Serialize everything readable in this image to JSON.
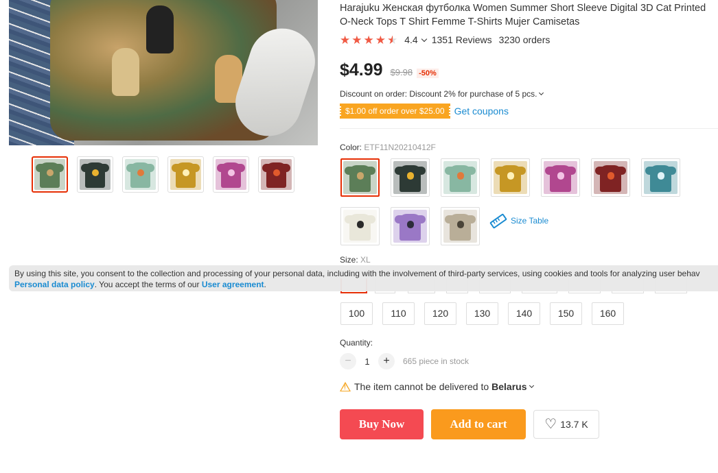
{
  "product": {
    "title": "Harajuku Женская футболка Women Summer Short Sleeve Digital 3D Cat Printed O-Neck Tops T Shirt Femme T-Shirts Mujer Camisetas",
    "rating": 4.4,
    "rating_text": "4.4",
    "reviews": "1351 Reviews",
    "orders": "3230 orders",
    "price": "$4.99",
    "old_price": "$9.98",
    "discount": "-50%",
    "order_discount": "Discount on order: Discount 2% for purchase of 5 pcs.",
    "coupon": "$1.00 off order over $25.00",
    "get_coupons": "Get coupons"
  },
  "gallery": {
    "thumbnails": [
      {
        "icon": "green-cat-tee",
        "color": "#5c7e58",
        "accent": "#c9a66b"
      },
      {
        "icon": "moon-cat-tee",
        "color": "#2d3a35",
        "accent": "#e9b22f"
      },
      {
        "icon": "mint-cat-tee",
        "color": "#88b7a2",
        "accent": "#e07a3b"
      },
      {
        "icon": "yellow-cat-tee",
        "color": "#c69724",
        "accent": "#fff1b8"
      },
      {
        "icon": "pink-cat-tee",
        "color": "#b1478f",
        "accent": "#f3c3e4"
      },
      {
        "icon": "red-cat-tee",
        "color": "#7f2323",
        "accent": "#e05a2c"
      }
    ]
  },
  "color": {
    "label": "Color:",
    "selected": "ETF11N20210412F",
    "options": [
      {
        "icon": "green-cat-tee",
        "color": "#5c7e58",
        "accent": "#c9a66b"
      },
      {
        "icon": "moon-cat-tee",
        "color": "#2d3a35",
        "accent": "#e9b22f"
      },
      {
        "icon": "mint-cat-tee",
        "color": "#88b7a2",
        "accent": "#e07a3b"
      },
      {
        "icon": "yellow-cat-tee",
        "color": "#c69724",
        "accent": "#fff1b8"
      },
      {
        "icon": "pink-cat-tee",
        "color": "#b1478f",
        "accent": "#f3c3e4"
      },
      {
        "icon": "red-cat-tee",
        "color": "#7f2323",
        "accent": "#e05a2c"
      },
      {
        "icon": "teal-cat-tee",
        "color": "#3f8a96",
        "accent": "#dff3f7"
      },
      {
        "icon": "white-cat-tee",
        "color": "#e9e7da",
        "accent": "#2a2a2a"
      },
      {
        "icon": "purple-cat-tee",
        "color": "#9a78c6",
        "accent": "#2c2c3a"
      },
      {
        "icon": "beige-cat-tee",
        "color": "#b9ae98",
        "accent": "#4a4438"
      }
    ],
    "size_table": "Size Table"
  },
  "size": {
    "label": "Size:",
    "selected": "XL",
    "options": [
      "100",
      "110",
      "120",
      "130",
      "140",
      "150",
      "160"
    ]
  },
  "quantity": {
    "label": "Quantity:",
    "value": "1",
    "minus": "−",
    "plus": "+",
    "stock": "665 piece in stock"
  },
  "delivery": {
    "text": "The item cannot be delivered to",
    "country": "Belarus"
  },
  "actions": {
    "buy_now": "Buy Now",
    "add_to_cart": "Add to cart",
    "wishlist_count": "13.7 K"
  },
  "cookie": {
    "text1": "By using this site, you consent to the collection and processing of your personal data, including with the involvement of third-party services, using cookies and tools for analyzing user behav",
    "link1": "Personal data policy",
    "text2": ". You accept the terms of our ",
    "link2": "User agreement",
    "text3": "."
  },
  "colors": {
    "accent_red": "#e62e04",
    "buy_now": "#f44a52",
    "add_to_cart": "#fa9a1d",
    "link_blue": "#1a8bd1",
    "coupon_orange": "#f9a521"
  }
}
